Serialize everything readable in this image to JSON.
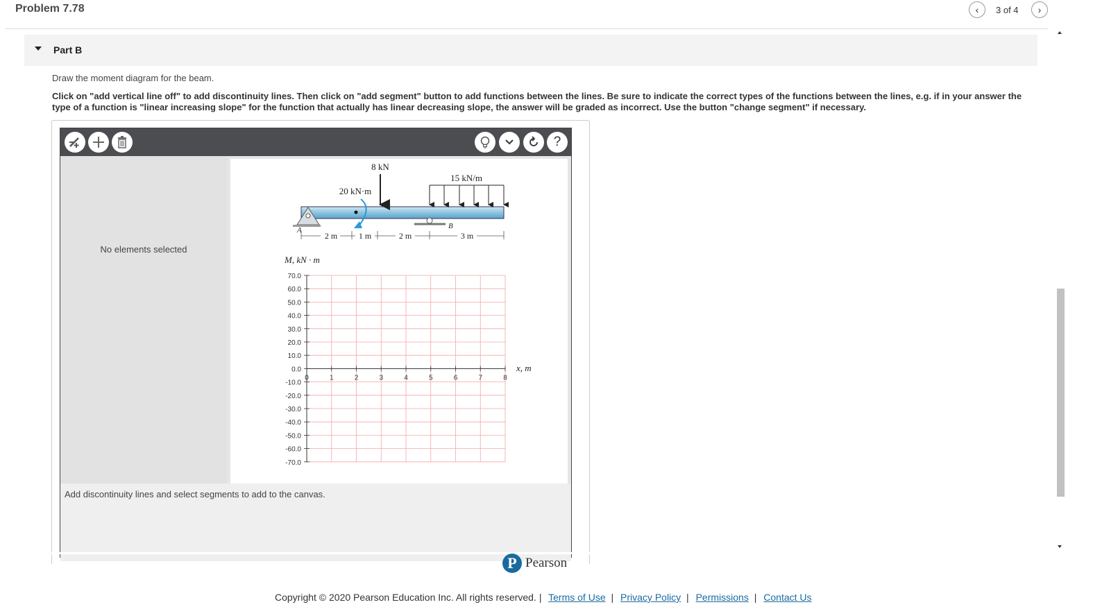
{
  "header": {
    "problem_title": "Problem 7.78",
    "pager_text": "3 of 4",
    "prev_icon": "chevron-left-icon",
    "next_icon": "chevron-right-icon"
  },
  "part": {
    "label": "Part B",
    "expanded": true
  },
  "instructions": {
    "line1": "Draw the moment diagram for the beam.",
    "line2": "Click on \"add vertical line off\" to add discontinuity lines. Then click on \"add segment\" button to add functions between the lines. Be sure to indicate the correct types of the functions between the lines, e.g. if in your answer the type of a function is \"linear increasing slope\" for the function that actually has linear decreasing slope, the answer will be graded as incorrect. Use the button \"change segment\" if necessary."
  },
  "toolbar": {
    "left_buttons": [
      "add-vertical-line-icon",
      "add-segment-icon",
      "trash-icon"
    ],
    "right_buttons": [
      "lightbulb-icon",
      "chevron-down-icon",
      "reset-icon",
      "help-icon"
    ],
    "help_glyph": "?"
  },
  "panel": {
    "no_selection": "No elements selected",
    "status": "Add discontinuity lines and select segments to add to the canvas."
  },
  "figure": {
    "load_point": "8 kN",
    "load_distributed": "15 kN/m",
    "moment": "20 kN·m",
    "support_a": "A",
    "support_b": "B",
    "dims": [
      "2 m",
      "1 m",
      "2 m",
      "3 m"
    ]
  },
  "plot": {
    "ylabel": "M,  kN · m",
    "xlabel": "x,  m",
    "y_ticks": [
      "70.0",
      "60.0",
      "50.0",
      "40.0",
      "30.0",
      "20.0",
      "10.0",
      "0.0",
      "-10.0",
      "-20.0",
      "-30.0",
      "-40.0",
      "-50.0",
      "-60.0",
      "-70.0"
    ],
    "x_ticks": [
      "0",
      "1",
      "2",
      "3",
      "4",
      "5",
      "6",
      "7",
      "8"
    ],
    "grid_color": "#f4a6a6"
  },
  "footer": {
    "brand": "Pearson",
    "copyright": "Copyright © 2020 Pearson Education Inc. All rights reserved.",
    "links": [
      "Terms of Use",
      "Privacy Policy",
      "Permissions",
      "Contact Us"
    ]
  }
}
